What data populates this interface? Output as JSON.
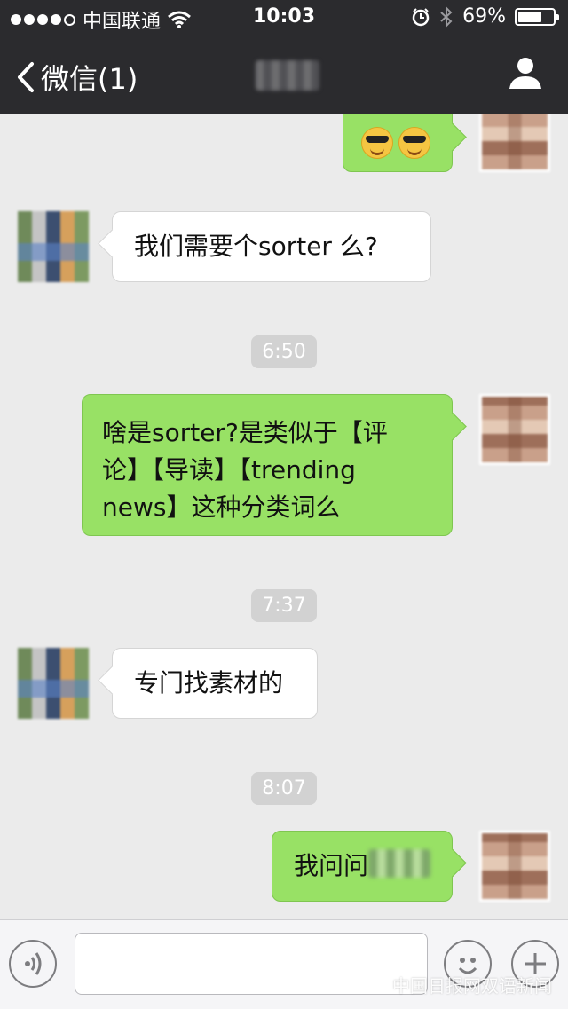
{
  "status_bar": {
    "carrier": "中国联通",
    "time": "10:03",
    "battery": "69%",
    "battery_level": 0.69
  },
  "nav": {
    "back_label": "微信(1)"
  },
  "messages": [
    {
      "type": "emoji",
      "side": "out",
      "emoji": [
        "sunglasses-smile",
        "sunglasses-smile"
      ]
    },
    {
      "type": "text",
      "side": "in",
      "text": "我们需要个sorter 么?"
    },
    {
      "type": "time",
      "text": "6:50"
    },
    {
      "type": "text",
      "side": "out",
      "lines": [
        "啥是sorter?是类似于【评",
        "论】【导读】【trending",
        "news】这种分类词么"
      ]
    },
    {
      "type": "time",
      "text": "7:37"
    },
    {
      "type": "text",
      "side": "in",
      "text": "专门找素材的"
    },
    {
      "type": "time",
      "text": "8:07"
    },
    {
      "type": "text",
      "side": "out",
      "text": "我问问"
    }
  ],
  "input_bar": {
    "placeholder": "",
    "watermark": "中国日报网双语新闻"
  },
  "colors": {
    "nav_bg": "#2b2b2e",
    "chat_bg": "#ebebeb",
    "out_bubble": "#98e165",
    "in_bubble": "#ffffff",
    "timestamp_bg": "#d2d2d2"
  }
}
